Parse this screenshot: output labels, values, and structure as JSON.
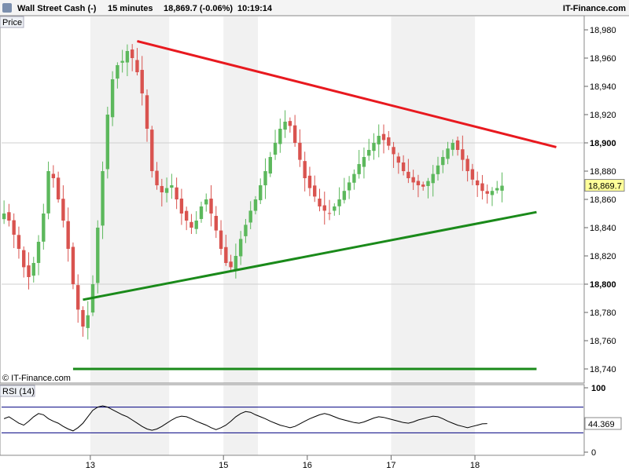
{
  "header": {
    "instrument": "Wall Street Cash (-)",
    "timeframe": "15 minutes",
    "quote": "18,869.7 (-0.06%)",
    "time": "10:19:14",
    "brand": "IT-Finance.com"
  },
  "price_panel": {
    "label": "Price",
    "watermark": "© IT-Finance.com",
    "current_price_label": "18,869.7"
  },
  "rsi_panel": {
    "label": "RSI (14)",
    "current_value_label": "44.369"
  },
  "colors": {
    "up_candle": "#5cb85c",
    "down_candle": "#d9534f",
    "resistance_line": "#e8191f",
    "support_line": "#1a8a1a",
    "rsi_line": "#000000",
    "rsi_bands": "#000080",
    "price_tag_bg": "#ffff99"
  },
  "chart_data": [
    {
      "type": "candlestick",
      "title": "Wall Street Cash (-)",
      "ylabel": "Price",
      "ylim": [
        18730,
        18990
      ],
      "y_ticks": [
        18740,
        18760,
        18780,
        18800,
        18820,
        18840,
        18860,
        18880,
        18900,
        18920,
        18940,
        18960,
        18980
      ],
      "y_tick_labels": [
        "18,740",
        "18,760",
        "18,780",
        "18,800",
        "18,820",
        "18,840",
        "18,860",
        "18,880",
        "18,900",
        "18,920",
        "18,940",
        "18,960",
        "18,980"
      ],
      "x_tick_labels": [
        "13",
        "15",
        "16",
        "17",
        "18"
      ],
      "x_ticks_bar_index": [
        18,
        45,
        62,
        79,
        96
      ],
      "shaded_sessions_bar_ranges": [
        [
          18,
          34
        ],
        [
          45,
          52
        ],
        [
          79,
          96
        ]
      ],
      "bars": 102,
      "close_series": [
        18850,
        18845,
        18835,
        18825,
        18812,
        18805,
        18815,
        18830,
        18850,
        18880,
        18875,
        18860,
        18845,
        18825,
        18800,
        18782,
        18770,
        18778,
        18800,
        18840,
        18880,
        18920,
        18945,
        18955,
        18958,
        18965,
        18960,
        18950,
        18935,
        18910,
        18880,
        18870,
        18865,
        18868,
        18870,
        18860,
        18850,
        18845,
        18840,
        18845,
        18855,
        18860,
        18850,
        18838,
        18825,
        18815,
        18812,
        18820,
        18832,
        18842,
        18852,
        18860,
        18870,
        18880,
        18890,
        18900,
        18910,
        18915,
        18912,
        18900,
        18888,
        18875,
        18868,
        18862,
        18855,
        18852,
        18850,
        18855,
        18860,
        18866,
        18872,
        18878,
        18885,
        18890,
        18895,
        18900,
        18905,
        18902,
        18898,
        18892,
        18886,
        18880,
        18875,
        18872,
        18870,
        18869,
        18873,
        18878,
        18884,
        18890,
        18896,
        18900,
        18895,
        18888,
        18880,
        18874,
        18870,
        18866,
        18864,
        18866,
        18868,
        18869.7
      ],
      "annotations": [
        {
          "kind": "trendline",
          "color": "red",
          "from": {
            "bar": 27,
            "price": 18972
          },
          "to": {
            "bar": 112,
            "price": 18897
          }
        },
        {
          "kind": "trendline",
          "color": "green",
          "from": {
            "bar": 16,
            "price": 18789
          },
          "to": {
            "bar": 108,
            "price": 18851
          }
        },
        {
          "kind": "horizontal",
          "color": "green",
          "price": 18740,
          "from_bar": 14,
          "to_bar": 108
        }
      ],
      "last_price": 18869.7
    },
    {
      "type": "line",
      "title": "RSI (14)",
      "ylim": [
        0,
        100
      ],
      "y_ticks": [
        0,
        100
      ],
      "bands": [
        30,
        70
      ],
      "last_value": 44.369,
      "values": [
        52,
        55,
        50,
        45,
        42,
        48,
        55,
        60,
        58,
        52,
        48,
        45,
        40,
        36,
        33,
        38,
        45,
        55,
        65,
        70,
        72,
        70,
        66,
        62,
        58,
        55,
        50,
        45,
        40,
        36,
        34,
        36,
        40,
        45,
        50,
        54,
        56,
        55,
        52,
        48,
        45,
        42,
        38,
        35,
        38,
        42,
        48,
        55,
        60,
        63,
        62,
        58,
        55,
        52,
        48,
        45,
        42,
        40,
        38,
        40,
        44,
        48,
        52,
        55,
        58,
        60,
        58,
        55,
        52,
        50,
        48,
        46,
        45,
        47,
        50,
        53,
        55,
        54,
        52,
        50,
        48,
        46,
        45,
        47,
        50,
        52,
        54,
        56,
        55,
        52,
        48,
        45,
        42,
        40,
        38,
        40,
        42,
        44,
        44.369
      ]
    }
  ]
}
